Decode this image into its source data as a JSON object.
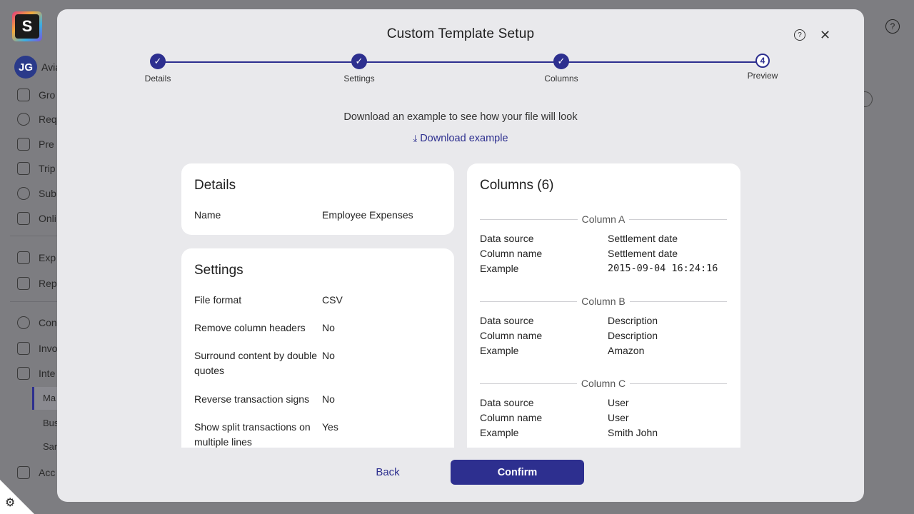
{
  "background": {
    "logo_letter": "S",
    "user": {
      "initials": "JG",
      "name_partial": "Avia"
    },
    "nav": [
      {
        "label": "Gro",
        "icon": "group-icon"
      },
      {
        "label": "Req",
        "icon": "chat-plus-icon"
      },
      {
        "label": "Pre",
        "icon": "camera-plus-icon"
      },
      {
        "label": "Trip",
        "icon": "plane-icon"
      },
      {
        "label": "Sub",
        "icon": "clock-icon"
      },
      {
        "label": "Onli",
        "icon": "megaphone-icon"
      },
      {
        "label": "Exp",
        "icon": "stack-icon"
      },
      {
        "label": "Rep",
        "icon": "report-icon"
      },
      {
        "label": "Con",
        "icon": "gear-icon"
      },
      {
        "label": "Invo",
        "icon": "invoice-icon"
      },
      {
        "label": "Inte",
        "icon": "plug-icon"
      },
      {
        "label": "Acc",
        "icon": "building-icon"
      }
    ],
    "subnav": [
      "Ma",
      "Bus",
      "Sar"
    ],
    "help_glyph": "?",
    "corner_glyph": "⚙"
  },
  "modal": {
    "title": "Custom Template Setup",
    "help_glyph": "?",
    "close_glyph": "✕",
    "steps": [
      {
        "label": "Details",
        "state": "done",
        "glyph": "✓"
      },
      {
        "label": "Settings",
        "state": "done",
        "glyph": "✓"
      },
      {
        "label": "Columns",
        "state": "done",
        "glyph": "✓"
      },
      {
        "label": "Preview",
        "state": "current",
        "glyph": "4"
      }
    ],
    "intro": "Download an example to see how your file will look",
    "download_glyph": "⤓",
    "download_label": "Download example",
    "details": {
      "title": "Details",
      "rows": [
        {
          "key": "Name",
          "value": "Employee Expenses"
        }
      ]
    },
    "settings": {
      "title": "Settings",
      "rows": [
        {
          "key": "File format",
          "value": "CSV"
        },
        {
          "key": "Remove column headers",
          "value": "No"
        },
        {
          "key": "Surround content by double quotes",
          "value": "No"
        },
        {
          "key": "Reverse transaction signs",
          "value": "No"
        },
        {
          "key": "Show split transactions on multiple lines",
          "value": "Yes"
        }
      ]
    },
    "columns": {
      "title": "Columns (6)",
      "items": [
        {
          "heading": "Column A",
          "rows": [
            {
              "key": "Data source",
              "value": "Settlement date"
            },
            {
              "key": "Column name",
              "value": "Settlement date"
            },
            {
              "key": "Example",
              "value": "2015-09-04 16:24:16"
            }
          ]
        },
        {
          "heading": "Column B",
          "rows": [
            {
              "key": "Data source",
              "value": "Description"
            },
            {
              "key": "Column name",
              "value": "Description"
            },
            {
              "key": "Example",
              "value": "Amazon"
            }
          ]
        },
        {
          "heading": "Column C",
          "rows": [
            {
              "key": "Data source",
              "value": "User"
            },
            {
              "key": "Column name",
              "value": "User"
            },
            {
              "key": "Example",
              "value": "Smith John"
            }
          ]
        }
      ]
    },
    "back_label": "Back",
    "confirm_label": "Confirm",
    "accent_color": "#2d2f8f"
  }
}
